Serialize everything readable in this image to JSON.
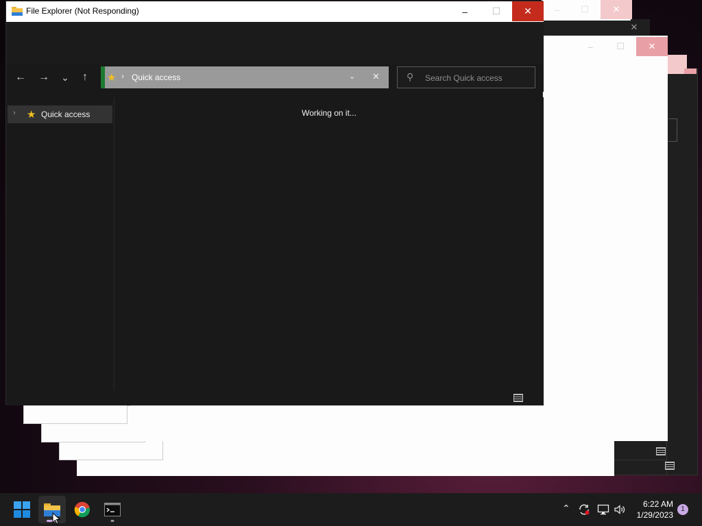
{
  "window": {
    "title": "File Explorer (Not Responding)",
    "minimize": "–",
    "maximize": "☐",
    "close": "✕"
  },
  "navigation": {
    "back": "←",
    "forward": "→",
    "recent": "⌄",
    "up": "↑"
  },
  "address": {
    "path": "Quick access",
    "separator": "›"
  },
  "search": {
    "placeholder": "Search Quick access"
  },
  "nav_pane": {
    "items": [
      {
        "label": "Quick access",
        "icon": "star-icon"
      }
    ]
  },
  "content": {
    "status": "Working on it..."
  },
  "taskbar": {
    "apps": [
      {
        "name": "Start",
        "icon": "windows-logo-icon"
      },
      {
        "name": "File Explorer",
        "icon": "folder-icon"
      },
      {
        "name": "Google Chrome",
        "icon": "chrome-icon"
      },
      {
        "name": "Terminal",
        "icon": "terminal-icon"
      }
    ],
    "clock": {
      "time": "6:22 AM",
      "date": "1/29/2023"
    },
    "notification_count": "1"
  },
  "colors": {
    "accent_close": "#c42b1c",
    "address_accent": "#1d7a2f",
    "star": "#f0c020"
  }
}
